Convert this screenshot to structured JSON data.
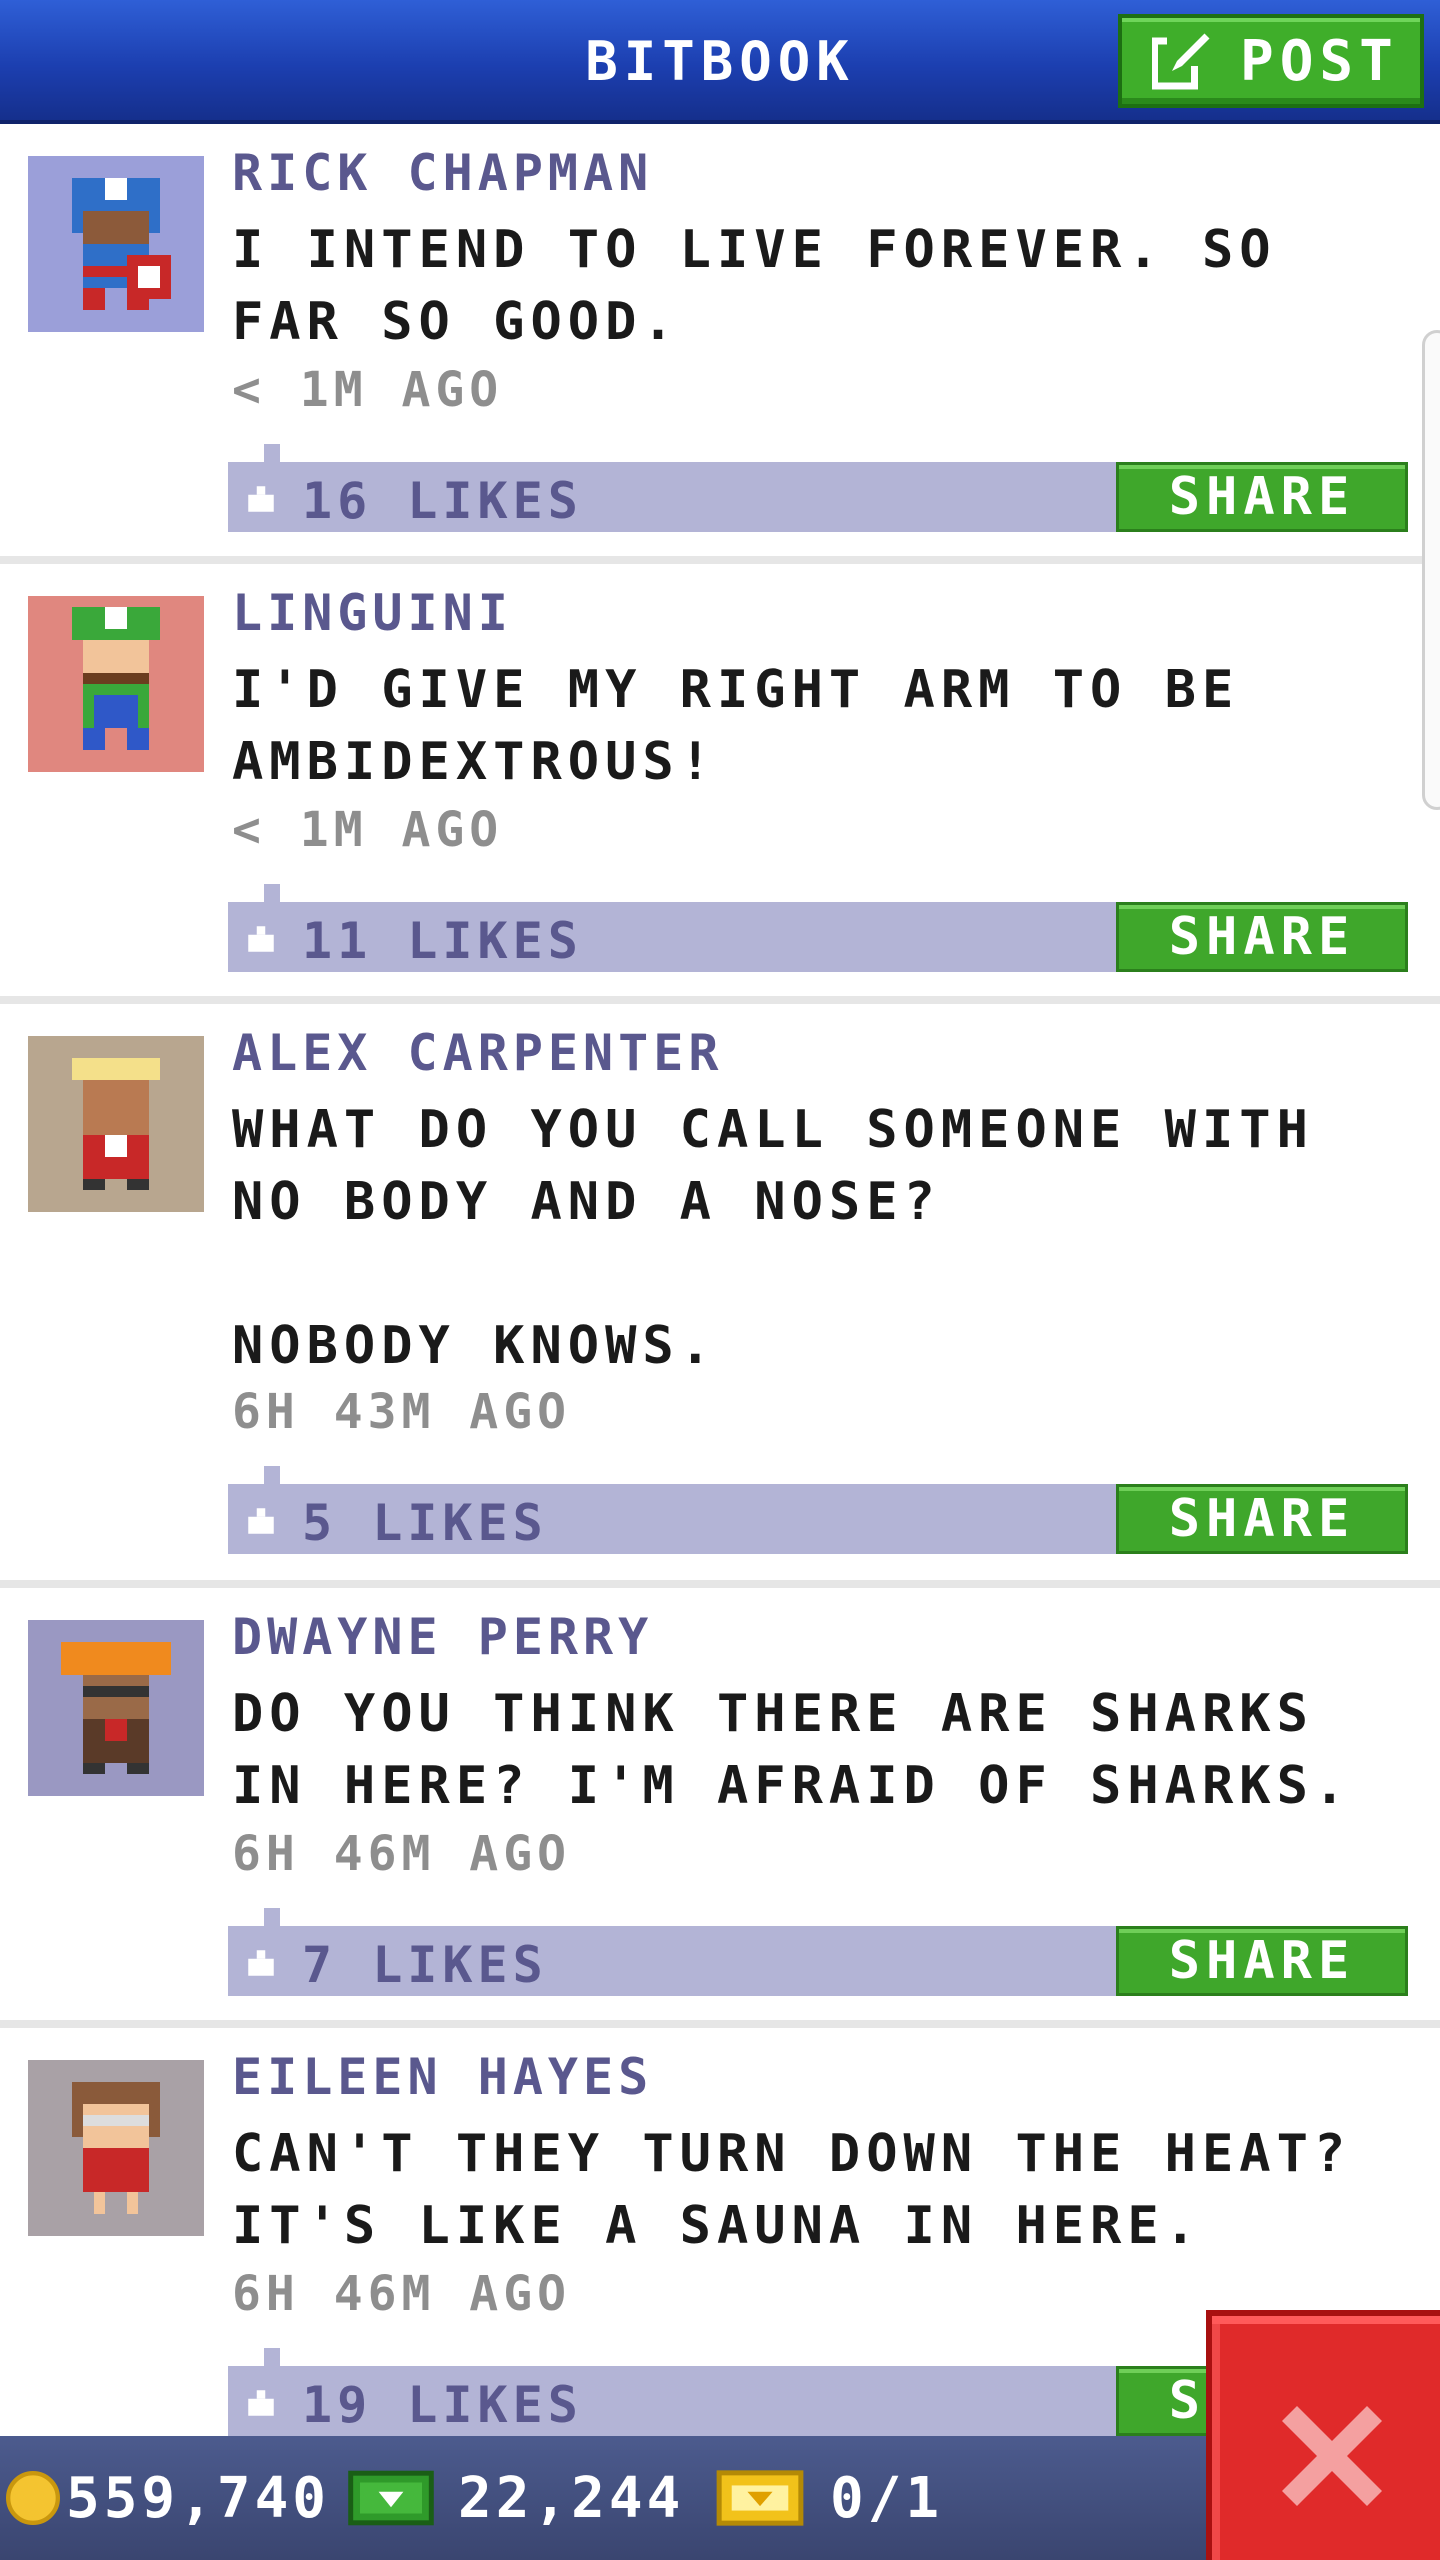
{
  "header": {
    "title": "BITBOOK",
    "post_label": "POST"
  },
  "posts": [
    {
      "name": "RICK CHAPMAN",
      "message": "I INTEND TO LIVE FOREVER. SO FAR SO GOOD.",
      "time": "< 1M AGO",
      "likes": "16 LIKES",
      "share": "SHARE",
      "avatar_bg": "#9b9fd9"
    },
    {
      "name": "LINGUINI",
      "message": "I'D GIVE MY RIGHT ARM TO BE AMBIDEXTROUS!",
      "time": "< 1M AGO",
      "likes": "11 LIKES",
      "share": "SHARE",
      "avatar_bg": "#e0877f"
    },
    {
      "name": "ALEX CARPENTER",
      "message": "WHAT DO YOU CALL SOMEONE WITH NO BODY AND A NOSE?\n\nNOBODY KNOWS.",
      "time": "6H 43M AGO",
      "likes": "5 LIKES",
      "share": "SHARE",
      "avatar_bg": "#b8a68f"
    },
    {
      "name": "DWAYNE PERRY",
      "message": "DO YOU THINK THERE ARE SHARKS IN HERE? I'M AFRAID OF SHARKS.",
      "time": "6H 46M AGO",
      "likes": "7 LIKES",
      "share": "SHARE",
      "avatar_bg": "#9a98c2"
    },
    {
      "name": "EILEEN HAYES",
      "message": "CAN'T THEY TURN DOWN THE HEAT? IT'S LIKE A SAUNA IN HERE.",
      "time": "6H 46M AGO",
      "likes": "19 LIKES",
      "share": "SHARE",
      "avatar_bg": "#a9a1a6"
    }
  ],
  "footer": {
    "coins": "559,740",
    "bux": "22,244",
    "tickets": "0/1"
  },
  "colors": {
    "accent_green": "#3fa72b",
    "header_blue": "#1c3fb0",
    "like_bar": "#b3b4d6",
    "close_red": "#e02a2a"
  }
}
